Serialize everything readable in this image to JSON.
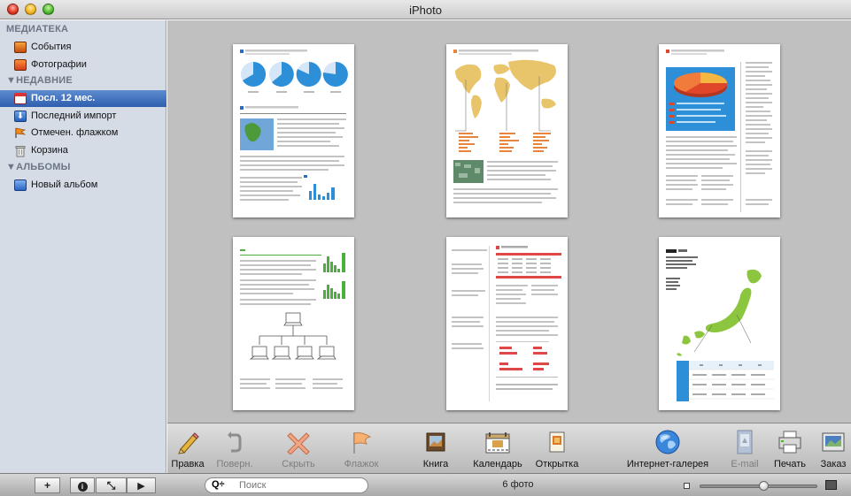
{
  "window": {
    "title": "iPhoto"
  },
  "sidebar": {
    "sections": [
      {
        "label": "МЕДИАТЕКА",
        "collapsible": false,
        "items": [
          {
            "label": "События",
            "icon": "events-icon"
          },
          {
            "label": "Фотографии",
            "icon": "photos-icon"
          }
        ]
      },
      {
        "label": "НЕДАВНИЕ",
        "collapsible": true,
        "items": [
          {
            "label": "Посл. 12 мес.",
            "icon": "calendar-icon",
            "selected": true
          },
          {
            "label": "Последний импорт",
            "icon": "import-icon"
          },
          {
            "label": "Отмечен. флажком",
            "icon": "flag-icon"
          },
          {
            "label": "Корзина",
            "icon": "trash-icon"
          }
        ]
      },
      {
        "label": "АЛЬБОМЫ",
        "collapsible": true,
        "items": [
          {
            "label": "Новый альбом",
            "icon": "album-icon"
          }
        ]
      }
    ]
  },
  "toolbar": {
    "items": [
      {
        "label": "Правка",
        "icon": "pencil-icon",
        "enabled": true
      },
      {
        "label": "Поверн.",
        "icon": "rotate-icon",
        "enabled": false
      },
      {
        "label": "Скрыть",
        "icon": "hide-x-icon",
        "enabled": false
      },
      {
        "label": "Флажок",
        "icon": "flag-icon",
        "enabled": false
      },
      {
        "label": "Книга",
        "icon": "book-icon",
        "enabled": true
      },
      {
        "label": "Календарь",
        "icon": "calendar-icon",
        "enabled": true
      },
      {
        "label": "Открытка",
        "icon": "card-icon",
        "enabled": true
      },
      {
        "label": "Интернет-галерея",
        "icon": "globe-icon",
        "enabled": true
      },
      {
        "label": "E-mail",
        "icon": "email-icon",
        "enabled": false
      },
      {
        "label": "Печать",
        "icon": "printer-icon",
        "enabled": true
      },
      {
        "label": "Заказ",
        "icon": "order-icon",
        "enabled": true
      }
    ]
  },
  "bottombar": {
    "buttons": [
      {
        "glyph": "+",
        "name": "add-album-button"
      },
      {
        "glyph": "i",
        "name": "info-button"
      },
      {
        "glyph": "⤡",
        "name": "fullscreen-button"
      },
      {
        "glyph": "▶",
        "name": "slideshow-button"
      }
    ],
    "search": {
      "menu_glyph": "Q÷",
      "placeholder": "Поиск",
      "value": ""
    },
    "photo_count": "6 фото",
    "zoom": 0.55
  },
  "photos": [
    {
      "kind": "pie-report"
    },
    {
      "kind": "world-map-report"
    },
    {
      "kind": "3d-pie-report"
    },
    {
      "kind": "network-report"
    },
    {
      "kind": "table-report"
    },
    {
      "kind": "japan-map-report"
    }
  ],
  "colors": {
    "accent_blue": "#2c8fd8",
    "map_gold": "#e8c56a",
    "bar_orange": "#e8843b",
    "bar_green": "#4cae3c",
    "pie_red": "#e0462a",
    "table_red": "#e04848",
    "lime": "#8cc63e"
  }
}
